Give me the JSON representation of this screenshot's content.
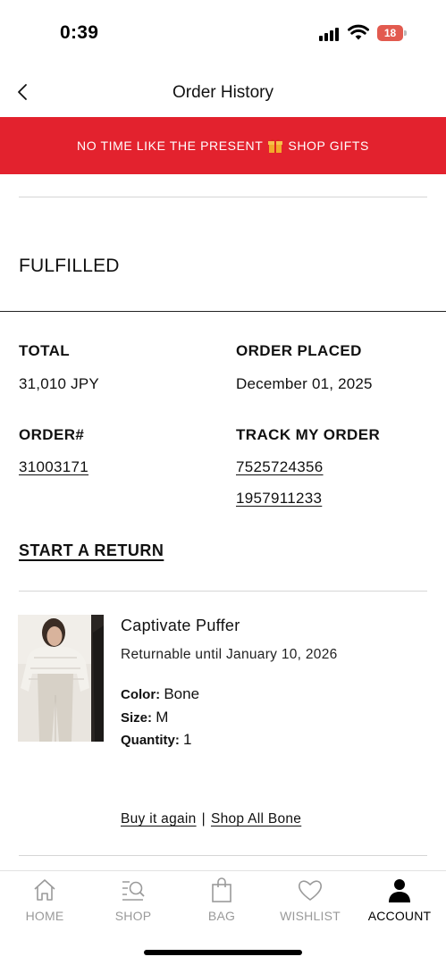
{
  "status_bar": {
    "time": "0:39",
    "battery": "18"
  },
  "header": {
    "title": "Order History"
  },
  "promo": {
    "text_before": "NO TIME LIKE THE PRESENT",
    "text_after": "SHOP GIFTS"
  },
  "order": {
    "status": "FULFILLED",
    "total_label": "TOTAL",
    "total_value": "31,010 JPY",
    "placed_label": "ORDER PLACED",
    "placed_value": "December 01, 2025",
    "order_number_label": "ORDER#",
    "order_number": "31003171",
    "track_label": "TRACK MY ORDER",
    "tracking_numbers": [
      "7525724356",
      "1957911233"
    ],
    "start_return": "START A RETURN"
  },
  "product": {
    "name": "Captivate Puffer",
    "returnable": "Returnable until January 10, 2026",
    "color_label": "Color:",
    "color_value": "Bone",
    "size_label": "Size:",
    "size_value": "M",
    "quantity_label": "Quantity:",
    "quantity_value": "1",
    "buy_again": "Buy it again",
    "separator": "|",
    "shop_all": "Shop All Bone"
  },
  "tabs": [
    {
      "label": "HOME",
      "icon": "home-icon",
      "active": false
    },
    {
      "label": "SHOP",
      "icon": "shop-search-icon",
      "active": false
    },
    {
      "label": "BAG",
      "icon": "bag-icon",
      "active": false
    },
    {
      "label": "WISHLIST",
      "icon": "heart-icon",
      "active": false
    },
    {
      "label": "ACCOUNT",
      "icon": "person-icon",
      "active": true
    }
  ],
  "colors": {
    "promo_bg": "#e3222e",
    "battery": "#e25a4f",
    "inactive_tab": "#9a9a9a"
  }
}
